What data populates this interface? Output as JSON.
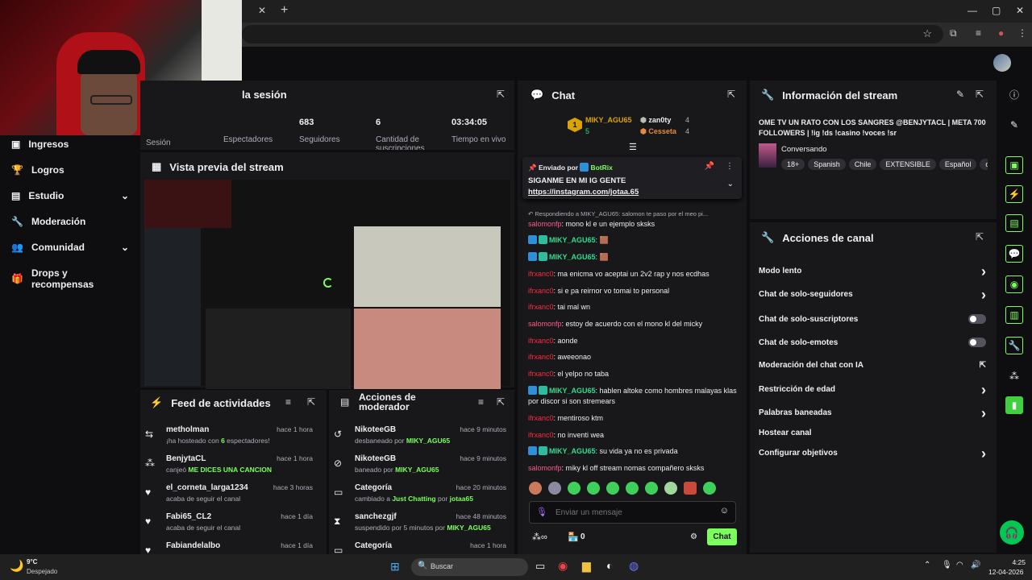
{
  "browser": {
    "new_tab": "+",
    "tab_close": "✕",
    "window_controls": [
      "—",
      "▢",
      "✕"
    ]
  },
  "nav": {
    "items": [
      {
        "label": "Ingresos",
        "icon": "money-icon",
        "chev": ""
      },
      {
        "label": "Logros",
        "icon": "trophy-icon",
        "chev": ""
      },
      {
        "label": "Estudio",
        "icon": "studio-icon",
        "chev": "⌄"
      },
      {
        "label": "Moderación",
        "icon": "wrench-icon",
        "chev": ""
      },
      {
        "label": "Comunidad",
        "icon": "people-icon",
        "chev": "⌄"
      },
      {
        "label": "Drops y recompensas",
        "icon": "gift-icon",
        "chev": ""
      }
    ]
  },
  "session": {
    "title": "la sesión",
    "stats": [
      {
        "value": "",
        "label": "Sesión"
      },
      {
        "value": "",
        "label": "Espectadores"
      },
      {
        "value": "683",
        "label": "Seguidores"
      },
      {
        "value": "6",
        "label": "Cantidad de suscripciones"
      },
      {
        "value": "03:34:05",
        "label": "Tiempo en vivo"
      }
    ]
  },
  "preview": {
    "title": "Vista previa del stream"
  },
  "feed": {
    "title": "Feed de actividades",
    "items": [
      {
        "icon": "host-icon",
        "name": "metholman",
        "pre": "¡ha hosteado con ",
        "hl": "6",
        "post": " espectadores!",
        "time": "hace 1 hora"
      },
      {
        "icon": "points-icon",
        "name": "BenjytaCL",
        "pre": "canjeó ",
        "hl": "ME DICES UNA CANCION",
        "post": "",
        "time": "hace 1 hora"
      },
      {
        "icon": "heart-icon",
        "name": "el_corneta_larga1234",
        "pre": "acaba de seguir el canal",
        "hl": "",
        "post": "",
        "time": "hace 3 horas"
      },
      {
        "icon": "heart-icon",
        "name": "Fabi65_CL2",
        "pre": "acaba de seguir el canal",
        "hl": "",
        "post": "",
        "time": "hace 1 día"
      },
      {
        "icon": "heart-icon",
        "name": "Fabiandelalbo",
        "pre": "",
        "hl": "",
        "post": "",
        "time": "hace 1 día"
      }
    ]
  },
  "mod_actions": {
    "title_line1": "Acciones de",
    "title_line2": "moderador",
    "items": [
      {
        "icon": "undo-icon",
        "name": "NikoteeGB",
        "pre": "desbaneado por ",
        "hl": "MIKY_AGU65",
        "mid": "",
        "hl2": "",
        "time": "hace 9 minutos"
      },
      {
        "icon": "ban-icon",
        "name": "NikoteeGB",
        "pre": "baneado por ",
        "hl": "MIKY_AGU65",
        "mid": "",
        "hl2": "",
        "time": "hace 9 minutos"
      },
      {
        "icon": "category-icon",
        "name": "Categoría",
        "pre": "cambiado a ",
        "hl": "Just Chatting",
        "mid": " por ",
        "hl2": "jotaa65",
        "time": "hace 20 minutos"
      },
      {
        "icon": "hourglass-icon",
        "name": "sanchezgjf",
        "pre": "suspendido por 5 minutos por ",
        "hl": "MIKY_AGU65",
        "mid": "",
        "hl2": "",
        "time": "hace 48 minutos"
      },
      {
        "icon": "category-icon",
        "name": "Categoría",
        "pre": "",
        "hl": "",
        "mid": "",
        "hl2": "",
        "time": "hace 1 hora"
      }
    ]
  },
  "chat": {
    "title": "Chat",
    "leader": {
      "name": "MIKY_AGU65",
      "rank": "1",
      "count": "5"
    },
    "top2": {
      "name": "zan0ty",
      "count": "4"
    },
    "top3": {
      "name": "Cesseta",
      "count": "4"
    },
    "pinned": {
      "header": "Enviado por",
      "by": "BotRix",
      "text": "SIGANME EN MI IG GENTE",
      "link": "https://instagram.com/jotaa.65"
    },
    "reply_hint": "Respondiendo a MIKY_AGU65: salomon te paso por el meo pi...",
    "messages": [
      {
        "user": "salomonfp",
        "cls": "user-pink",
        "badges": 0,
        "text": ": mono kl e un ejemplo sksks"
      },
      {
        "user": "MIKY_AGU65",
        "cls": "user-green",
        "badges": 2,
        "text": ": 🟫"
      },
      {
        "user": "MIKY_AGU65",
        "cls": "user-green",
        "badges": 2,
        "text": ": 🟫"
      },
      {
        "user": "ifrxanc0",
        "cls": "user-red",
        "badges": 0,
        "text": ": ma enicma vo aceptai un 2v2 rap y nos ecdhas"
      },
      {
        "user": "ifrxanc0",
        "cls": "user-red",
        "badges": 0,
        "text": ": si e pa reirnor vo tomai to personal"
      },
      {
        "user": "ifrxanc0",
        "cls": "user-red",
        "badges": 0,
        "text": ": tai mal wn"
      },
      {
        "user": "salomonfp",
        "cls": "user-pink",
        "badges": 0,
        "text": ": estoy de acuerdo con el mono kl del micky"
      },
      {
        "user": "ifrxanc0",
        "cls": "user-red",
        "badges": 0,
        "text": ": aonde"
      },
      {
        "user": "ifrxanc0",
        "cls": "user-red",
        "badges": 0,
        "text": ": aweeonao"
      },
      {
        "user": "ifrxanc0",
        "cls": "user-red",
        "badges": 0,
        "text": ": el yelpo no taba"
      },
      {
        "user": "MIKY_AGU65",
        "cls": "user-green",
        "badges": 2,
        "text": ": hablen altoke como hombres malayas klas por discor si son stremears"
      },
      {
        "user": "ifrxanc0",
        "cls": "user-red",
        "badges": 0,
        "text": ": mentiroso ktm"
      },
      {
        "user": "ifrxanc0",
        "cls": "user-red",
        "badges": 0,
        "text": ": no inventi wea"
      },
      {
        "user": "MIKY_AGU65",
        "cls": "user-green",
        "badges": 2,
        "text": ": su vida ya no es privada"
      },
      {
        "user": "salomonfp",
        "cls": "user-pink",
        "badges": 0,
        "text": ": miky kl off stream nomas compañero sksks"
      }
    ],
    "input_placeholder": "Enviar un mensaje",
    "points": "0",
    "send_label": "Chat"
  },
  "stream_info": {
    "title": "Información del stream",
    "stream_title": "OME TV UN RATO CON LOS SANGRES @BENJYTACL | META 700 FOLLOWERS | !ig !ds !casino !voces !sr",
    "category": "Conversando",
    "tags": [
      "18+",
      "Spanish",
      "Chile",
      "EXTENSIBLE",
      "Español",
      "c"
    ]
  },
  "channel_actions": {
    "title": "Acciones de canal",
    "rows": [
      {
        "label": "Modo lento",
        "right": "chevron"
      },
      {
        "label": "Chat de solo-seguidores",
        "right": "chevron"
      },
      {
        "label": "Chat de solo-suscriptores",
        "right": "toggle"
      },
      {
        "label": "Chat de solo-emotes",
        "right": "toggle"
      },
      {
        "label": "Moderación del chat con IA",
        "right": "external"
      },
      {
        "label": "Restricción de edad",
        "right": "chevron"
      },
      {
        "label": "Palabras baneadas",
        "right": "chevron"
      },
      {
        "label": "Hostear canal",
        "right": "none"
      },
      {
        "label": "Configurar objetivos",
        "right": "chevron"
      }
    ]
  },
  "taskbar": {
    "weather_temp": "9°C",
    "weather_desc": "Despejado",
    "search_placeholder": "Buscar",
    "time": "4:25",
    "date": "12-04-2026"
  },
  "colors": {
    "accent_green": "#7cff5c",
    "panel_bg": "#18181b",
    "page_bg": "#0e0e10"
  }
}
